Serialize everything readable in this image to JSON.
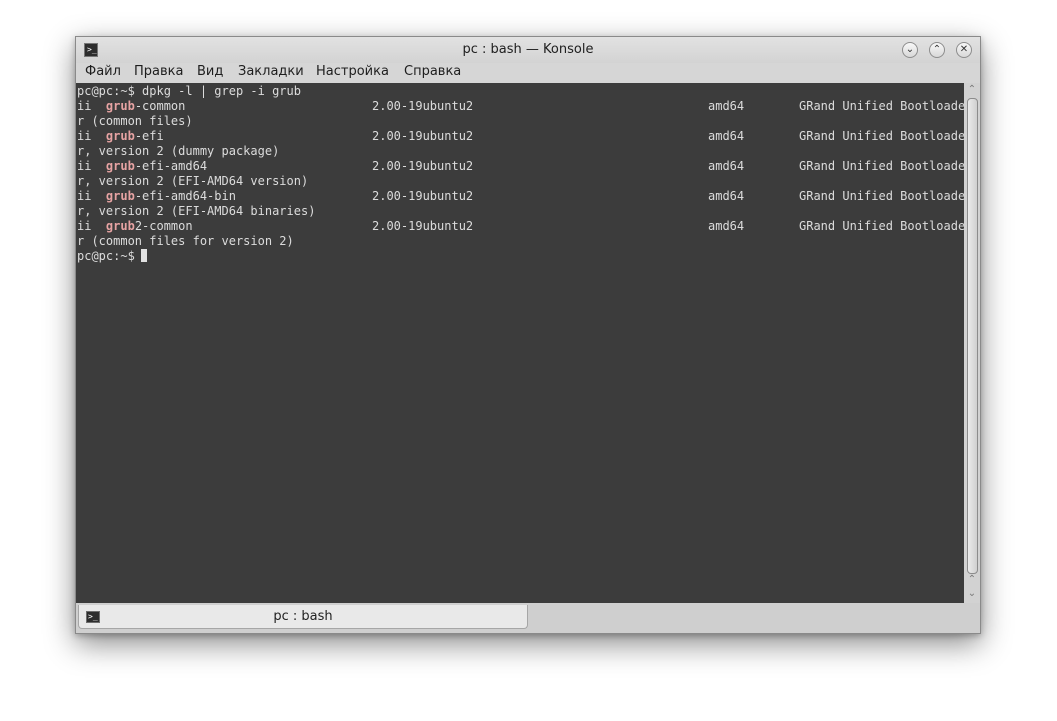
{
  "window": {
    "title": "pc : bash — Konsole",
    "controls": {
      "minimize": "⌄",
      "maximize": "⌃",
      "close": "✕"
    }
  },
  "menubar": [
    "Файл",
    "Правка",
    "Вид",
    "Закладки",
    "Настройка",
    "Справка"
  ],
  "terminal": {
    "prompt": "pc@pc:~$",
    "command": "dpkg -l | grep -i grub",
    "rows": [
      {
        "status": "ii",
        "match": "grub",
        "rest": "-common",
        "version": "2.00-19ubuntu2",
        "arch": "amd64",
        "desc": "GRand Unified Bootloade",
        "wrap": "r (common files)"
      },
      {
        "status": "ii",
        "match": "grub",
        "rest": "-efi",
        "version": "2.00-19ubuntu2",
        "arch": "amd64",
        "desc": "GRand Unified Bootloade",
        "wrap": "r, version 2 (dummy package)"
      },
      {
        "status": "ii",
        "match": "grub",
        "rest": "-efi-amd64",
        "version": "2.00-19ubuntu2",
        "arch": "amd64",
        "desc": "GRand Unified Bootloade",
        "wrap": "r, version 2 (EFI-AMD64 version)"
      },
      {
        "status": "ii",
        "match": "grub",
        "rest": "-efi-amd64-bin",
        "version": "2.00-19ubuntu2",
        "arch": "amd64",
        "desc": "GRand Unified Bootloade",
        "wrap": "r, version 2 (EFI-AMD64 binaries)"
      },
      {
        "status": "ii",
        "match": "grub",
        "rest": "2-common",
        "version": "2.00-19ubuntu2",
        "arch": "amd64",
        "desc": "GRand Unified Bootloade",
        "wrap": "r (common files for version 2)"
      }
    ]
  },
  "tabs": [
    {
      "label": "pc : bash"
    }
  ],
  "icons": {
    "app": "terminal-icon",
    "tab": "terminal-icon"
  }
}
